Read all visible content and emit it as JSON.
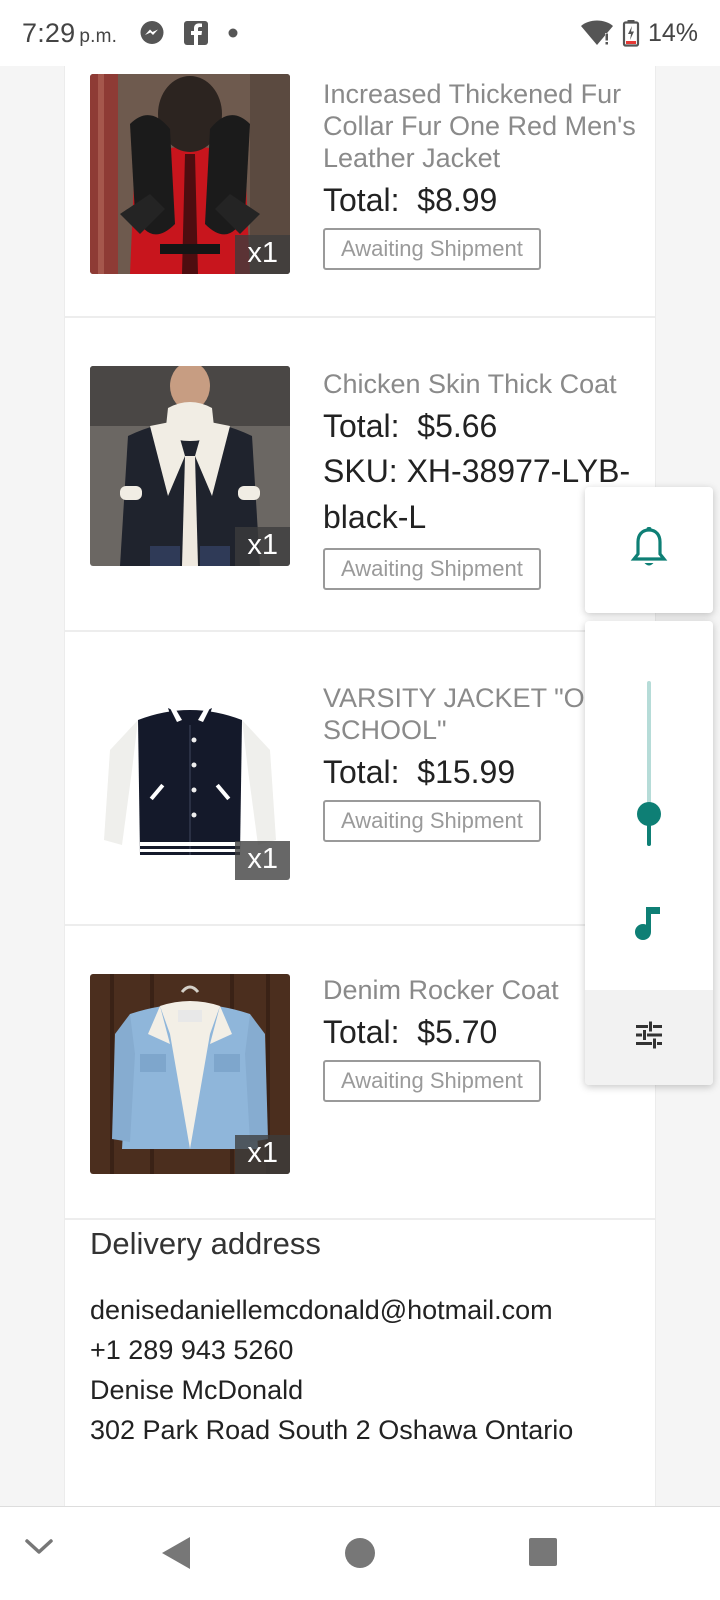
{
  "status_bar": {
    "time": "7:29",
    "ampm": "p.m.",
    "battery": "14%",
    "icons": [
      "messenger-icon",
      "facebook-icon",
      "notification-dot-icon",
      "wifi-icon",
      "battery-icon"
    ]
  },
  "order_items": [
    {
      "name": "Increased Thickened Fur Collar Fur One Red Men's Leather Jacket",
      "total_label": "Total:",
      "total": "$8.99",
      "qty": "x1",
      "status": "Awaiting Shipment",
      "thumb_colors": [
        "#c8151d",
        "#1a1a1a",
        "#7c6a5c"
      ]
    },
    {
      "name": "Chicken Skin Thick Coat",
      "total_label": "Total:",
      "total": "$5.66",
      "sku_label": "SKU:",
      "sku": "XH-38977-LYB-black-L",
      "qty": "x1",
      "status": "Awaiting Shipment",
      "thumb_colors": [
        "#1f232d",
        "#f1ede4",
        "#5c5a57"
      ]
    },
    {
      "name": "VARSITY JACKET \"OLD SCHOOL\"",
      "total_label": "Total:",
      "total": "$15.99",
      "qty": "x1",
      "status": "Awaiting Shipment",
      "thumb_colors": [
        "#14192a",
        "#efefec",
        "#ffffff"
      ]
    },
    {
      "name": "Denim Rocker Coat",
      "total_label": "Total:",
      "total": "$5.70",
      "qty": "x1",
      "status": "Awaiting Shipment",
      "thumb_colors": [
        "#8fb6da",
        "#f3efe6",
        "#4b2e1e"
      ]
    }
  ],
  "delivery": {
    "title": "Delivery address",
    "email": "denisedaniellemcdonald@hotmail.com",
    "phone": "+1 289 943 5260",
    "name": "Denise  McDonald",
    "address": "302 Park Road South  2 Oshawa Ontario"
  },
  "volume_panel": {
    "accent": "#0e7f75",
    "level": 0.2,
    "icons": [
      "bell-icon",
      "music-note-icon",
      "equalizer-settings-icon"
    ]
  },
  "nav_bar": {
    "icons": [
      "chevron-down-icon",
      "back-icon",
      "home-icon",
      "recents-icon"
    ]
  }
}
